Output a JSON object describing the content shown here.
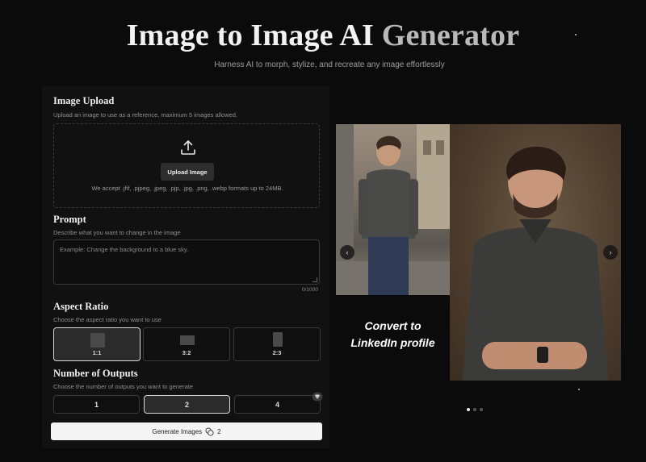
{
  "hero": {
    "title_main": "Image to Image AI",
    "title_fade": "Generator",
    "subtitle": "Harness AI to morph, stylize, and recreate any image effortlessly"
  },
  "upload": {
    "title": "Image Upload",
    "description": "Upload an image to use as a reference, maximum 5 images allowed.",
    "button_label": "Upload Image",
    "formats": "We accept .jfif, .pjpeg, .jpeg, .pjp, .jpg, .png, .webp formats up to 24MB.",
    "icon": "upload-icon"
  },
  "prompt": {
    "title": "Prompt",
    "description": "Describe what you want to change in the image",
    "placeholder": "Example: Change the background to a blue sky.",
    "char_count": "0/1000"
  },
  "aspect_ratio": {
    "title": "Aspect Ratio",
    "description": "Choose the aspect ratio you want to use",
    "options": [
      "1:1",
      "3:2",
      "2:3"
    ],
    "selected": "1:1"
  },
  "outputs": {
    "title": "Number of Outputs",
    "description": "Choose the number of outputs you want to generate",
    "options": [
      "1",
      "2",
      "4"
    ],
    "selected": "2"
  },
  "generate": {
    "label": "Generate Images",
    "cost": "2"
  },
  "showcase": {
    "caption_line1": "Convert to",
    "caption_line2": "LinkedIn profile",
    "prev_icon": "chevron-left-icon",
    "next_icon": "chevron-right-icon",
    "dots": 3,
    "active_dot": 0
  },
  "colors": {
    "background": "#0b0b0b",
    "panel": "#111111",
    "accent_button": "#f4f4f4"
  }
}
